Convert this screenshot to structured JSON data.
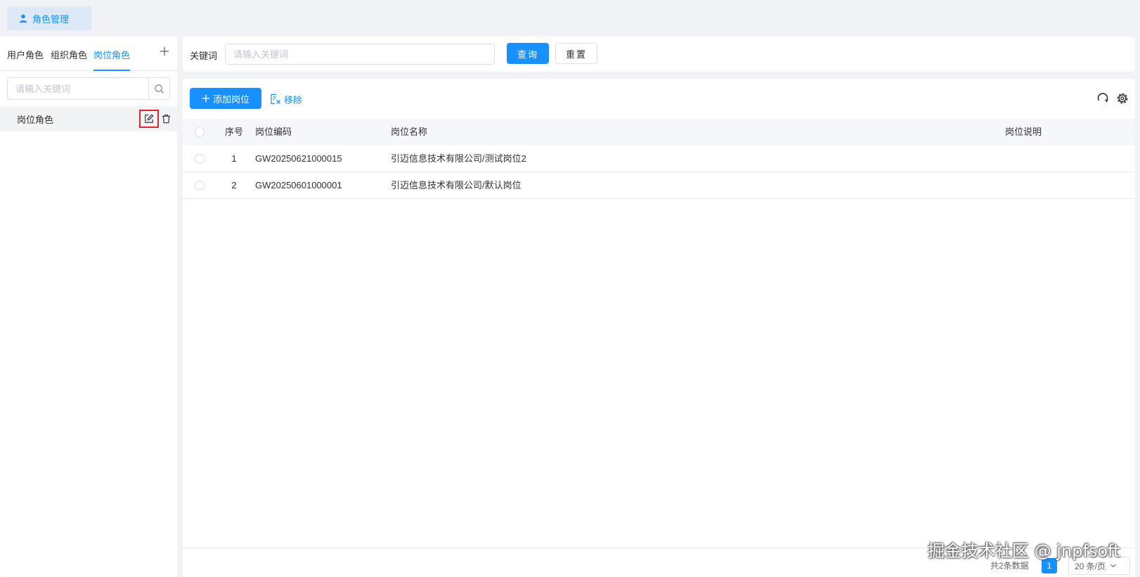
{
  "page_tab": {
    "label": "角色管理",
    "icon": "user-icon"
  },
  "left": {
    "tabs": [
      {
        "label": "用户角色"
      },
      {
        "label": "组织角色"
      },
      {
        "label": "岗位角色"
      }
    ],
    "search_placeholder": "请输入关键词",
    "items": [
      {
        "label": "岗位角色"
      }
    ]
  },
  "query": {
    "keyword_label": "关键词",
    "keyword_placeholder": "请输入关键词",
    "search_label": "查询",
    "reset_label": "重置"
  },
  "toolbar": {
    "add_label": "添加岗位",
    "remove_label": "移除"
  },
  "table": {
    "columns": [
      "序号",
      "岗位编码",
      "岗位名称",
      "岗位说明"
    ],
    "rows": [
      {
        "index": "1",
        "code": "GW20250621000015",
        "name": "引迈信息技术有限公司/测试岗位2",
        "desc": ""
      },
      {
        "index": "2",
        "code": "GW20250601000001",
        "name": "引迈信息技术有限公司/默认岗位",
        "desc": ""
      }
    ]
  },
  "pagination": {
    "total": "共2条数据",
    "current": "1",
    "page_size": "20 条/页"
  },
  "watermark": "掘金技术社区 @ jnpfsoft",
  "colors": {
    "primary": "#1890ff",
    "highlight": "#e0262b"
  }
}
